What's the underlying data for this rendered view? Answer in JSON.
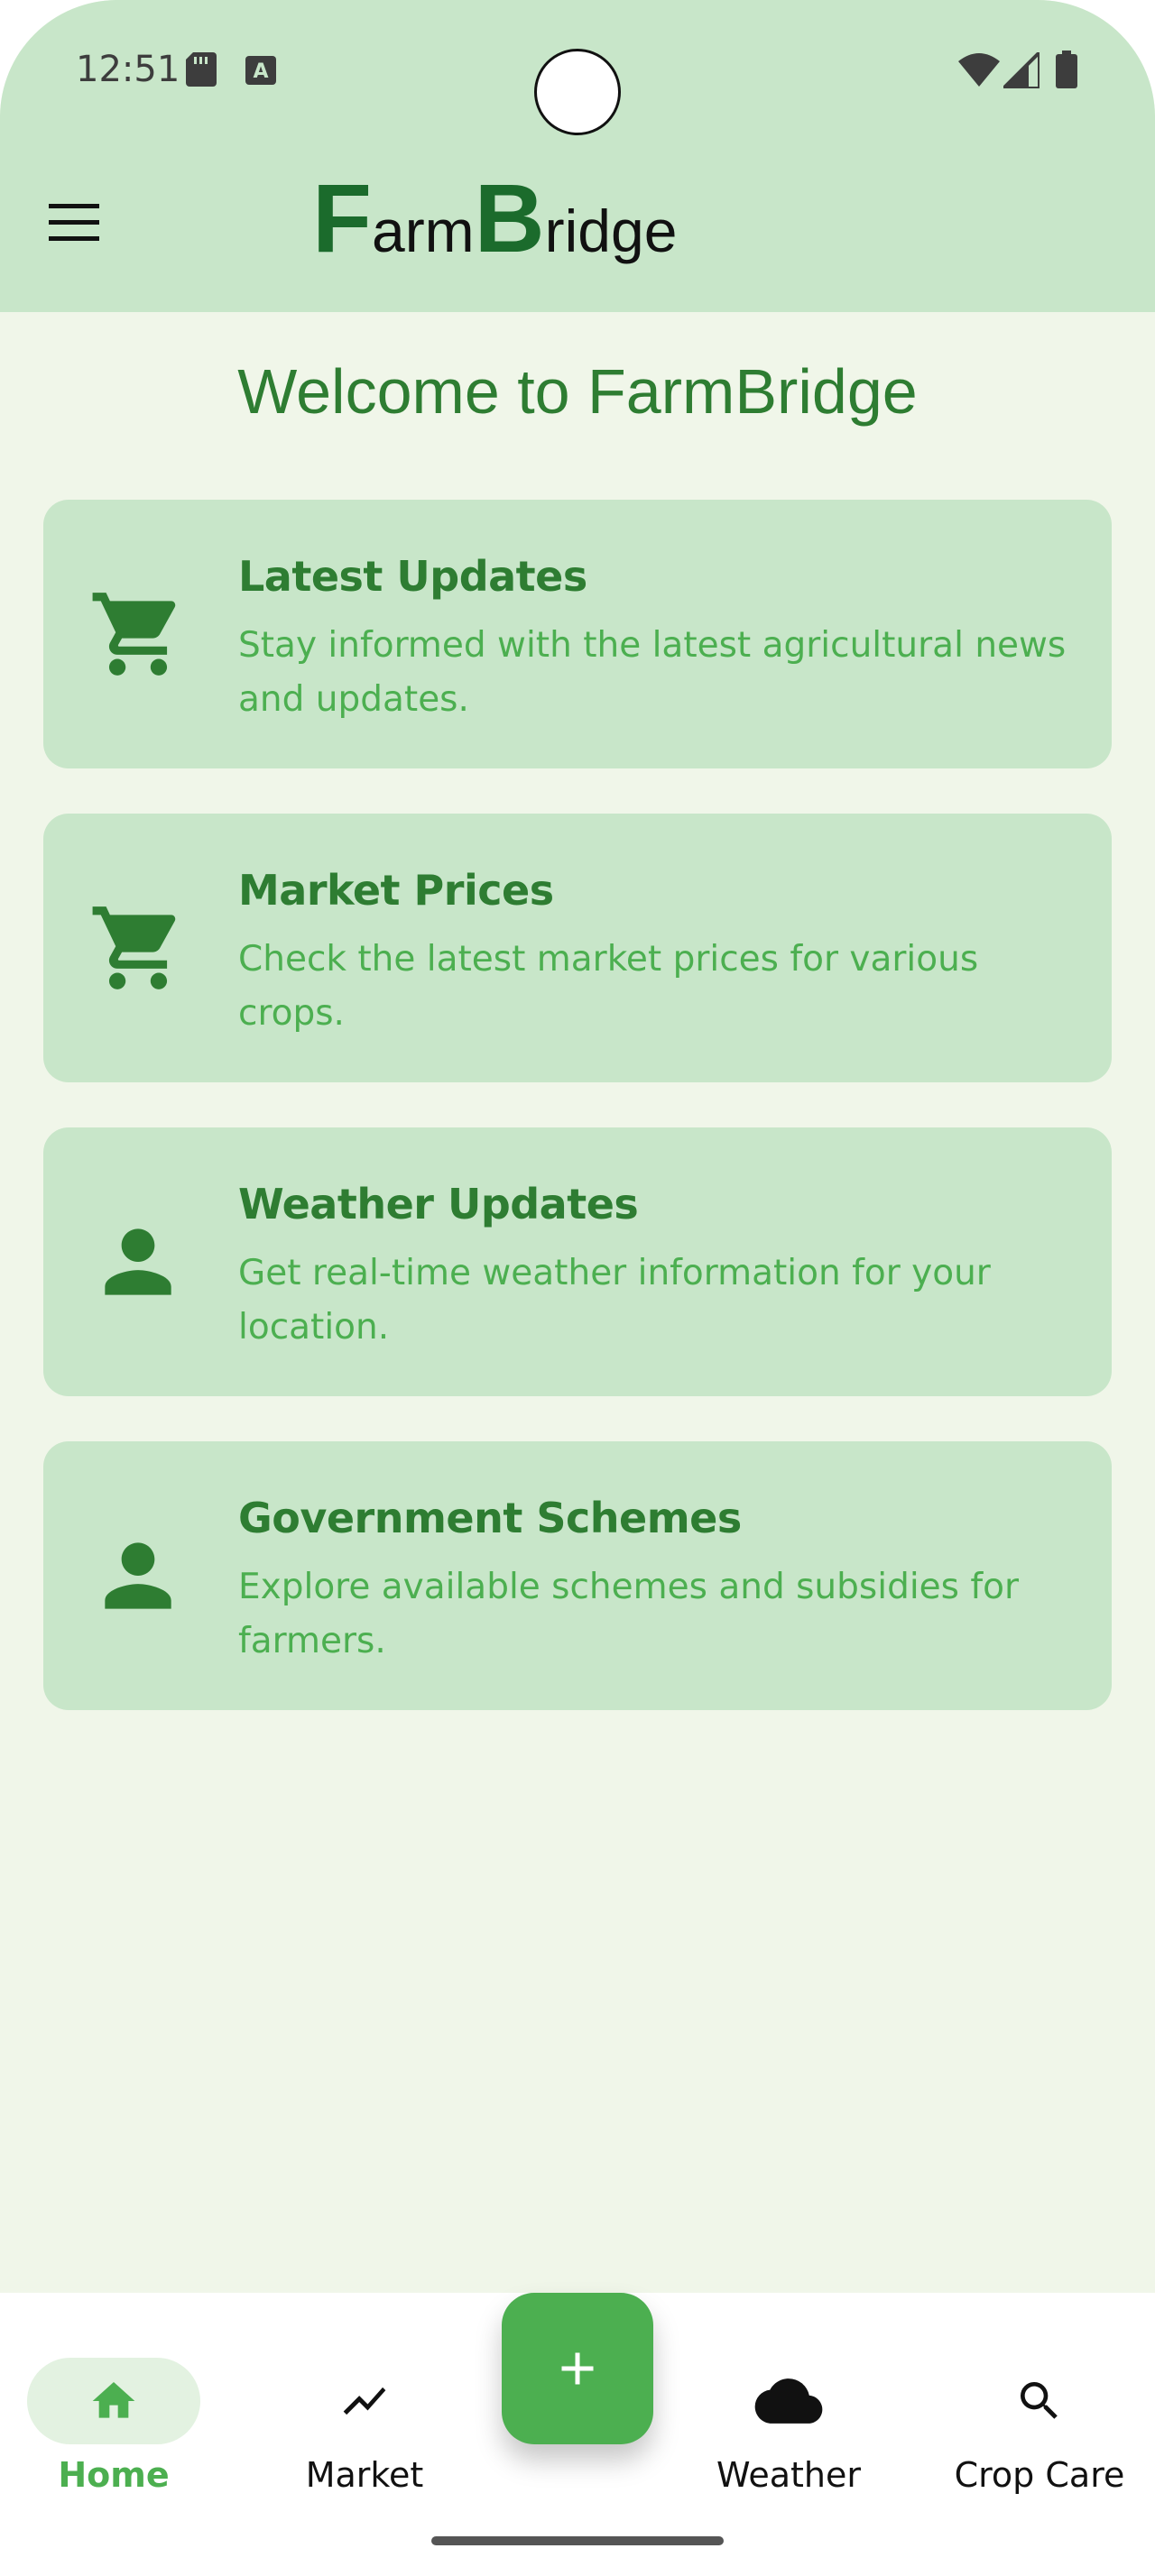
{
  "status_bar": {
    "time": "12:51",
    "icons": [
      "sd-card-icon",
      "a-notification-icon",
      "wifi-icon",
      "signal-icon",
      "battery-icon"
    ]
  },
  "header": {
    "logo_big_f": "F",
    "logo_rest_1": "arm",
    "logo_big_b": "B",
    "logo_rest_2": "ridge",
    "menu_icon": "hamburger-menu-icon"
  },
  "main": {
    "welcome": "Welcome to FarmBridge",
    "cards": [
      {
        "title": "Latest Updates",
        "description": "Stay informed with the latest agricultural news and updates.",
        "icon": "cart-icon"
      },
      {
        "title": "Market Prices",
        "description": "Check the latest market prices for various crops.",
        "icon": "cart-icon"
      },
      {
        "title": "Weather Updates",
        "description": "Get real-time weather information for your location.",
        "icon": "person-icon"
      },
      {
        "title": "Government Schemes",
        "description": "Explore available schemes and subsidies for farmers.",
        "icon": "person-icon"
      }
    ]
  },
  "bottom_nav": {
    "items": [
      {
        "label": "Home",
        "icon": "home-icon",
        "active": true
      },
      {
        "label": "Market",
        "icon": "trend-icon",
        "active": false
      },
      {
        "label": "Weather",
        "icon": "cloud-icon",
        "active": false
      },
      {
        "label": "Crop Care",
        "icon": "search-icon",
        "active": false
      }
    ],
    "fab_icon": "plus-icon"
  },
  "colors": {
    "header_bg": "#c8e6c9",
    "page_bg": "#f0f6e9",
    "accent": "#4caf50",
    "dark_green": "#2e7d32",
    "logo_green": "#1b6b2c"
  }
}
